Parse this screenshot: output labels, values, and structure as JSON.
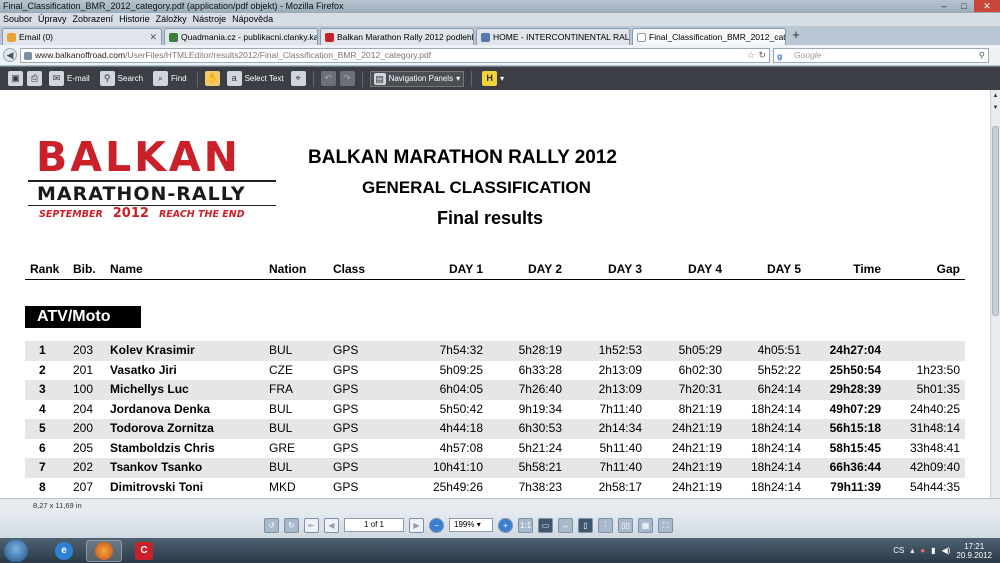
{
  "window": {
    "title": "Final_Classification_BMR_2012_category.pdf (application/pdf objekt) - Mozilla Firefox",
    "controls": [
      "–",
      "□",
      "✕"
    ]
  },
  "menu": [
    "Soubor",
    "Úpravy",
    "Zobrazení",
    "Historie",
    "Záložky",
    "Nástroje",
    "Nápověda"
  ],
  "tabs": [
    {
      "label": "Email (0)",
      "icon_color": "#e8a23a",
      "active": false
    },
    {
      "label": "Quadmania.cz - publikacni.clanky.ka...",
      "icon_color": "#3a7d3a",
      "active": false
    },
    {
      "label": "Balkan Marathon Rally 2012 podlehl č...",
      "icon_color": "#c9202a",
      "active": false
    },
    {
      "label": "HOME - INTERCONTINENTAL RALLY...",
      "icon_color": "#5577aa",
      "active": false
    },
    {
      "label": "Final_Classification_BMR_2012_categ...",
      "icon_color": "#ffffff",
      "active": true
    }
  ],
  "nav": {
    "url_domain": "www.balkanoffroad.com",
    "url_path": "/UserFiles/HTMLEditor/results2012/Final_Classification_BMR_2012_category.pdf",
    "search_placeholder": "Google",
    "search_logo": "g"
  },
  "pdf_toolbar": {
    "email_label": "E-mail",
    "search_label": "Search",
    "find_label": "Find",
    "select_text_label": "Select Text",
    "nav_panels_label": "Navigation Panels",
    "h_label": "H"
  },
  "document": {
    "logo": {
      "top": "BALKAN",
      "mid": "MARATHON-RALLY",
      "bottom_left": "SEPTEMBER",
      "year": "2012",
      "bottom_right": "REACH THE END"
    },
    "title": "BALKAN MARATHON RALLY 2012",
    "subtitle": "GENERAL CLASSIFICATION",
    "subtitle2": "Final results",
    "headers": {
      "rank": "Rank",
      "bib": "Bib.",
      "name": "Name",
      "nation": "Nation",
      "class": "Class",
      "d1": "DAY 1",
      "d2": "DAY 2",
      "d3": "DAY 3",
      "d4": "DAY 4",
      "d5": "DAY 5",
      "time": "Time",
      "gap": "Gap"
    },
    "section": "ATV/Moto",
    "rows": [
      {
        "rank": "1",
        "bib": "203",
        "name": "Kolev Krasimir",
        "nation": "BUL",
        "class": "GPS",
        "d1": "7h54:32",
        "d2": "5h28:19",
        "d3": "1h52:53",
        "d4": "5h05:29",
        "d5": "4h05:51",
        "time": "24h27:04",
        "gap": ""
      },
      {
        "rank": "2",
        "bib": "201",
        "name": "Vasatko Jiri",
        "nation": "CZE",
        "class": "GPS",
        "d1": "5h09:25",
        "d2": "6h33:28",
        "d3": "2h13:09",
        "d4": "6h02:30",
        "d5": "5h52:22",
        "time": "25h50:54",
        "gap": "1h23:50"
      },
      {
        "rank": "3",
        "bib": "100",
        "name": "Michellys Luc",
        "nation": "FRA",
        "class": "GPS",
        "d1": "6h04:05",
        "d2": "7h26:40",
        "d3": "2h13:09",
        "d4": "7h20:31",
        "d5": "6h24:14",
        "time": "29h28:39",
        "gap": "5h01:35"
      },
      {
        "rank": "4",
        "bib": "204",
        "name": "Jordanova Denka",
        "nation": "BUL",
        "class": "GPS",
        "d1": "5h50:42",
        "d2": "9h19:34",
        "d3": "7h11:40",
        "d4": "8h21:19",
        "d5": "18h24:14",
        "time": "49h07:29",
        "gap": "24h40:25"
      },
      {
        "rank": "5",
        "bib": "200",
        "name": "Todorova Zornitza",
        "nation": "BUL",
        "class": "GPS",
        "d1": "4h44:18",
        "d2": "6h30:53",
        "d3": "2h14:34",
        "d4": "24h21:19",
        "d5": "18h24:14",
        "time": "56h15:18",
        "gap": "31h48:14"
      },
      {
        "rank": "6",
        "bib": "205",
        "name": "Stamboldzis Chris",
        "nation": "GRE",
        "class": "GPS",
        "d1": "4h57:08",
        "d2": "5h21:24",
        "d3": "5h11:40",
        "d4": "24h21:19",
        "d5": "18h24:14",
        "time": "58h15:45",
        "gap": "33h48:41"
      },
      {
        "rank": "7",
        "bib": "202",
        "name": "Tsankov Tsanko",
        "nation": "BUL",
        "class": "GPS",
        "d1": "10h41:10",
        "d2": "5h58:21",
        "d3": "7h11:40",
        "d4": "24h21:19",
        "d5": "18h24:14",
        "time": "66h36:44",
        "gap": "42h09:40"
      },
      {
        "rank": "8",
        "bib": "207",
        "name": "Dimitrovski Toni",
        "nation": "MKD",
        "class": "GPS",
        "d1": "25h49:26",
        "d2": "7h38:23",
        "d3": "2h58:17",
        "d4": "24h21:19",
        "d5": "18h24:14",
        "time": "79h11:39",
        "gap": "54h44:35"
      }
    ]
  },
  "status": {
    "page_size": "8,27 x 11,69 in"
  },
  "viewer": {
    "page_indicator": "1 of 1",
    "zoom": "199%"
  },
  "taskbar": {
    "lang": "CS",
    "time": "17:21",
    "date": "20.9.2012"
  }
}
